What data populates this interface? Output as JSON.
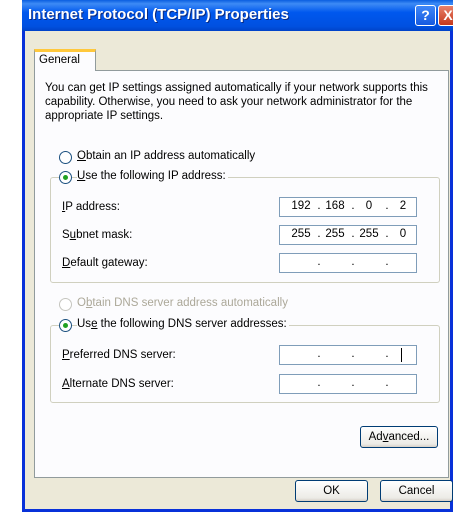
{
  "window": {
    "title": "Internet Protocol (TCP/IP) Properties",
    "help_symbol": "?",
    "close_symbol": "X"
  },
  "tabs": [
    {
      "label": "General",
      "selected": true
    }
  ],
  "intro_text": "You can get IP settings assigned automatically if your network supports this capability. Otherwise, you need to ask your network administrator for the appropriate IP settings.",
  "ip_options": {
    "auto": {
      "label": "Obtain an IP address automatically",
      "selected": false
    },
    "manual": {
      "label": "Use the following IP address:",
      "selected": true
    }
  },
  "ip_fields": {
    "ip_address": {
      "label": "IP address:",
      "octets": [
        "192",
        "168",
        "0",
        "2"
      ]
    },
    "subnet_mask": {
      "label": "Subnet mask:",
      "octets": [
        "255",
        "255",
        "255",
        "0"
      ]
    },
    "default_gateway": {
      "label": "Default gateway:",
      "octets": [
        "",
        "",
        "",
        ""
      ]
    }
  },
  "dns_options": {
    "auto": {
      "label": "Obtain DNS server address automatically",
      "selected": false,
      "disabled": true
    },
    "manual": {
      "label": "Use the following DNS server addresses:",
      "selected": true
    }
  },
  "dns_fields": {
    "preferred": {
      "label": "Preferred DNS server:",
      "octets": [
        "",
        "",
        "",
        ""
      ]
    },
    "alternate": {
      "label": "Alternate DNS server:",
      "octets": [
        "",
        "",
        "",
        ""
      ]
    }
  },
  "buttons": {
    "advanced": "Advanced...",
    "ok": "OK",
    "cancel": "Cancel"
  },
  "colors": {
    "titlebar": "#0058ee",
    "dialog_bg": "#ece9d8",
    "radio_dot": "#21a121",
    "tab_highlight": "#ffc83c"
  }
}
